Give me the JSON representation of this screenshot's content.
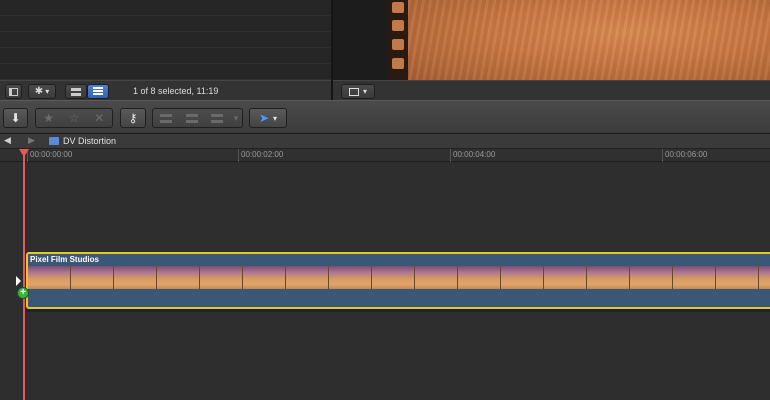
{
  "browser": {
    "status_text": "1 of 8 selected, 11:19"
  },
  "timeline": {
    "project_name": "DV Distortion",
    "ruler": [
      "00:00:00:00",
      "00:00:02:00",
      "00:00:04:00",
      "00:00:06:00"
    ],
    "clip_title": "Pixel Film Studios"
  },
  "icons": {
    "nav_back": "◀",
    "nav_forward": "▶",
    "gear": "✱",
    "dropdown": "▾",
    "import": "⬇",
    "star_favorite": "★",
    "star_unrate": "☆",
    "reject": "✕",
    "keyword": "⚷",
    "select_tool": "➤"
  },
  "colors": {
    "clip_border": "#e3c72c",
    "clip_fill": "#3b5776",
    "playhead": "#e45a5a",
    "add_badge": "#3cb53c"
  }
}
